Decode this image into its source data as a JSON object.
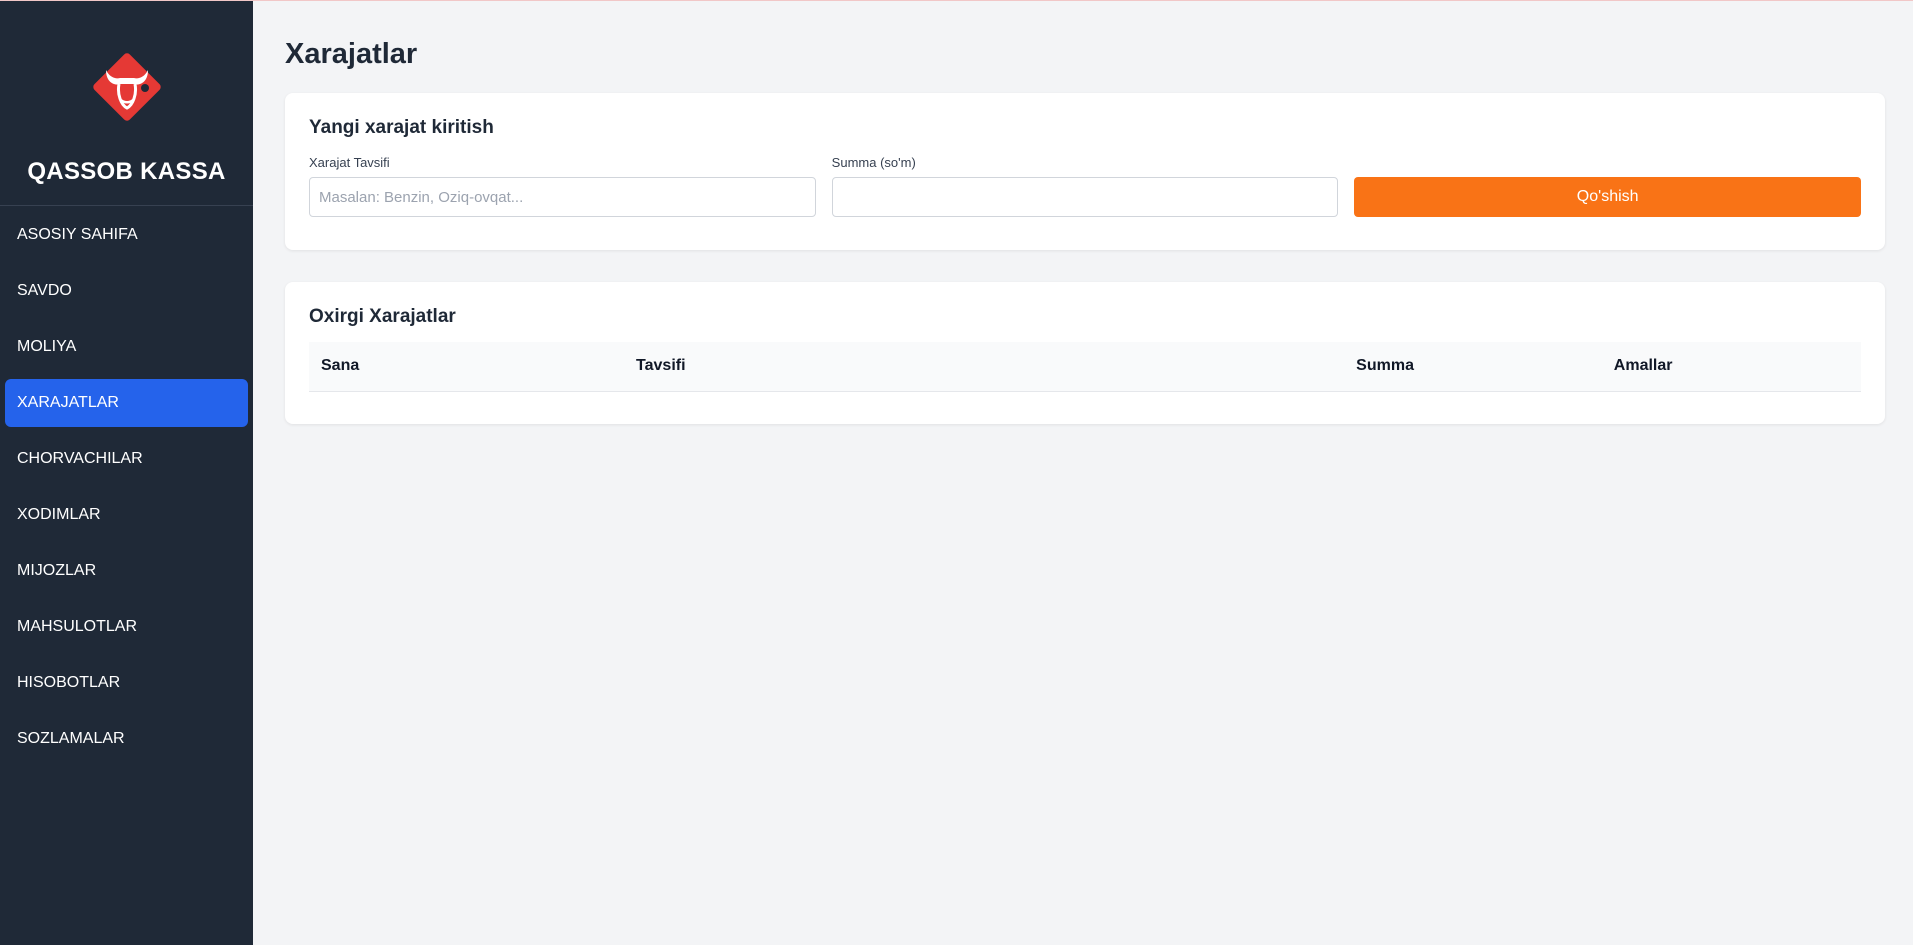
{
  "brand": {
    "name": "QASSOB KASSA",
    "logo_icon": "bull-head-icon",
    "logo_color": "#e53935"
  },
  "sidebar": {
    "items": [
      {
        "label": "ASOSIY SAHIFA",
        "active": false
      },
      {
        "label": "SAVDO",
        "active": false
      },
      {
        "label": "MOLIYA",
        "active": false
      },
      {
        "label": "XARAJATLAR",
        "active": true
      },
      {
        "label": "CHORVACHILAR",
        "active": false
      },
      {
        "label": "XODIMLAR",
        "active": false
      },
      {
        "label": "MIJOZLAR",
        "active": false
      },
      {
        "label": "MAHSULOTLAR",
        "active": false
      },
      {
        "label": "HISOBOTLAR",
        "active": false
      },
      {
        "label": "SOZLAMALAR",
        "active": false
      }
    ]
  },
  "page": {
    "title": "Xarajatlar"
  },
  "form": {
    "title": "Yangi xarajat kiritish",
    "description_label": "Xarajat Tavsifi",
    "description_placeholder": "Masalan: Benzin, Oziq-ovqat...",
    "description_value": "",
    "amount_label": "Summa (so'm)",
    "amount_value": "",
    "submit_label": "Qo'shish"
  },
  "list": {
    "title": "Oxirgi Xarajatlar",
    "columns": [
      "Sana",
      "Tavsifi",
      "Summa",
      "Amallar"
    ],
    "rows": []
  },
  "colors": {
    "sidebar_bg": "#1f2937",
    "active_nav": "#2563eb",
    "accent_button": "#f97316",
    "page_bg": "#f3f4f6"
  }
}
